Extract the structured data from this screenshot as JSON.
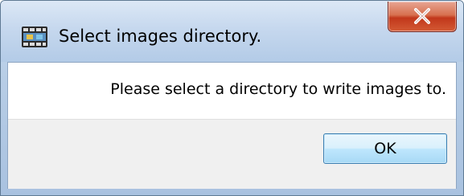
{
  "window": {
    "title": "Select images directory.",
    "app_icon": "video-app-icon",
    "close_icon": "close-icon"
  },
  "dialog": {
    "message": "Please select a directory to write images to.",
    "ok_label": "OK"
  },
  "colors": {
    "close_button": "#c9452a",
    "ok_button_border": "#3c7fb1",
    "footer_background": "#f0f0f0"
  }
}
